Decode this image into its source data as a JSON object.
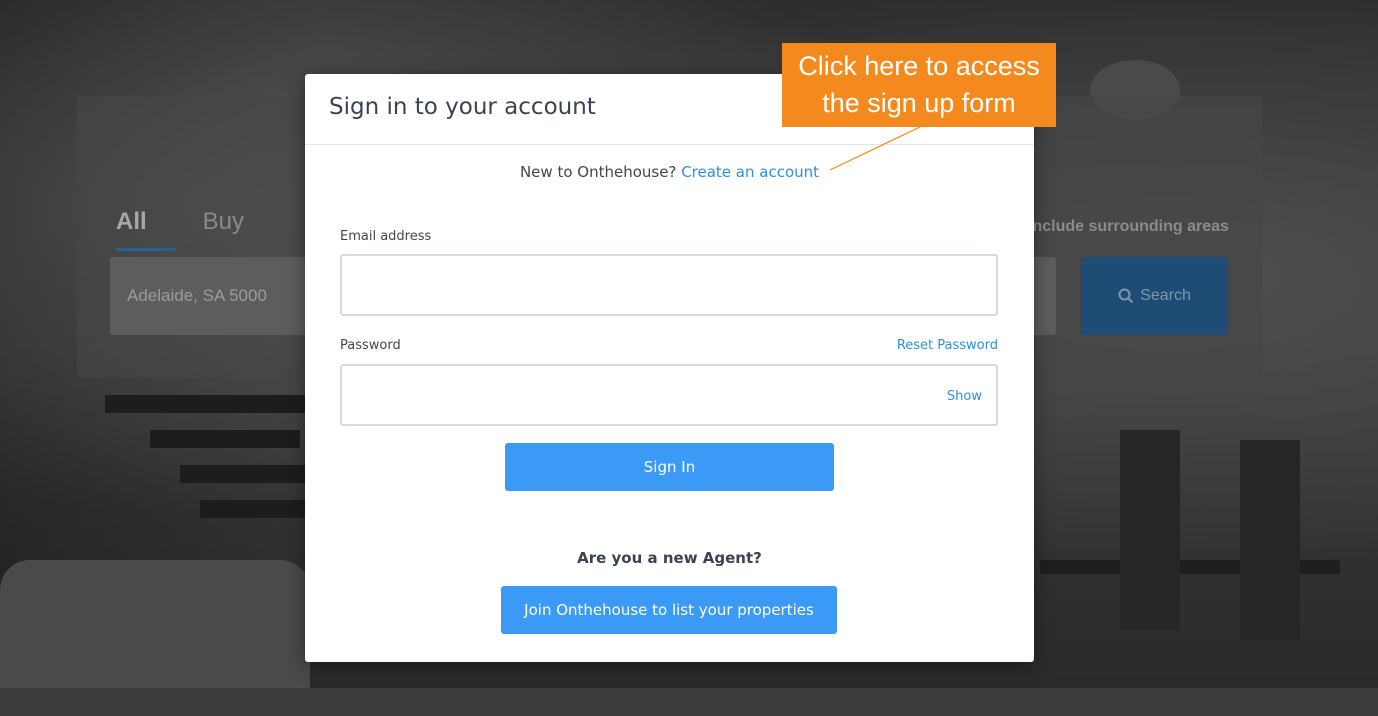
{
  "background": {
    "search_tabs": [
      "All",
      "Buy"
    ],
    "surrounding_label": "Include surrounding areas",
    "search_value": "Adelaide, SA 5000",
    "search_button_label": "Search"
  },
  "modal": {
    "title": "Sign in to your account",
    "new_user_prompt": "New to Onthehouse?",
    "create_account_link": "Create an account",
    "email_label": "Email address",
    "email_value": "",
    "password_label": "Password",
    "reset_password_link": "Reset Password",
    "show_toggle": "Show",
    "sign_in_button": "Sign In",
    "agent_question": "Are you a new Agent?",
    "join_button": "Join Onthehouse to list your properties"
  },
  "callout": {
    "line1": "Click here to access",
    "line2": "the sign up form",
    "color": "#f48a1e"
  },
  "colors": {
    "link": "#2f8fdc",
    "primary_button": "#3b9af5"
  },
  "icons": {
    "search_button_icon": "search-icon"
  }
}
